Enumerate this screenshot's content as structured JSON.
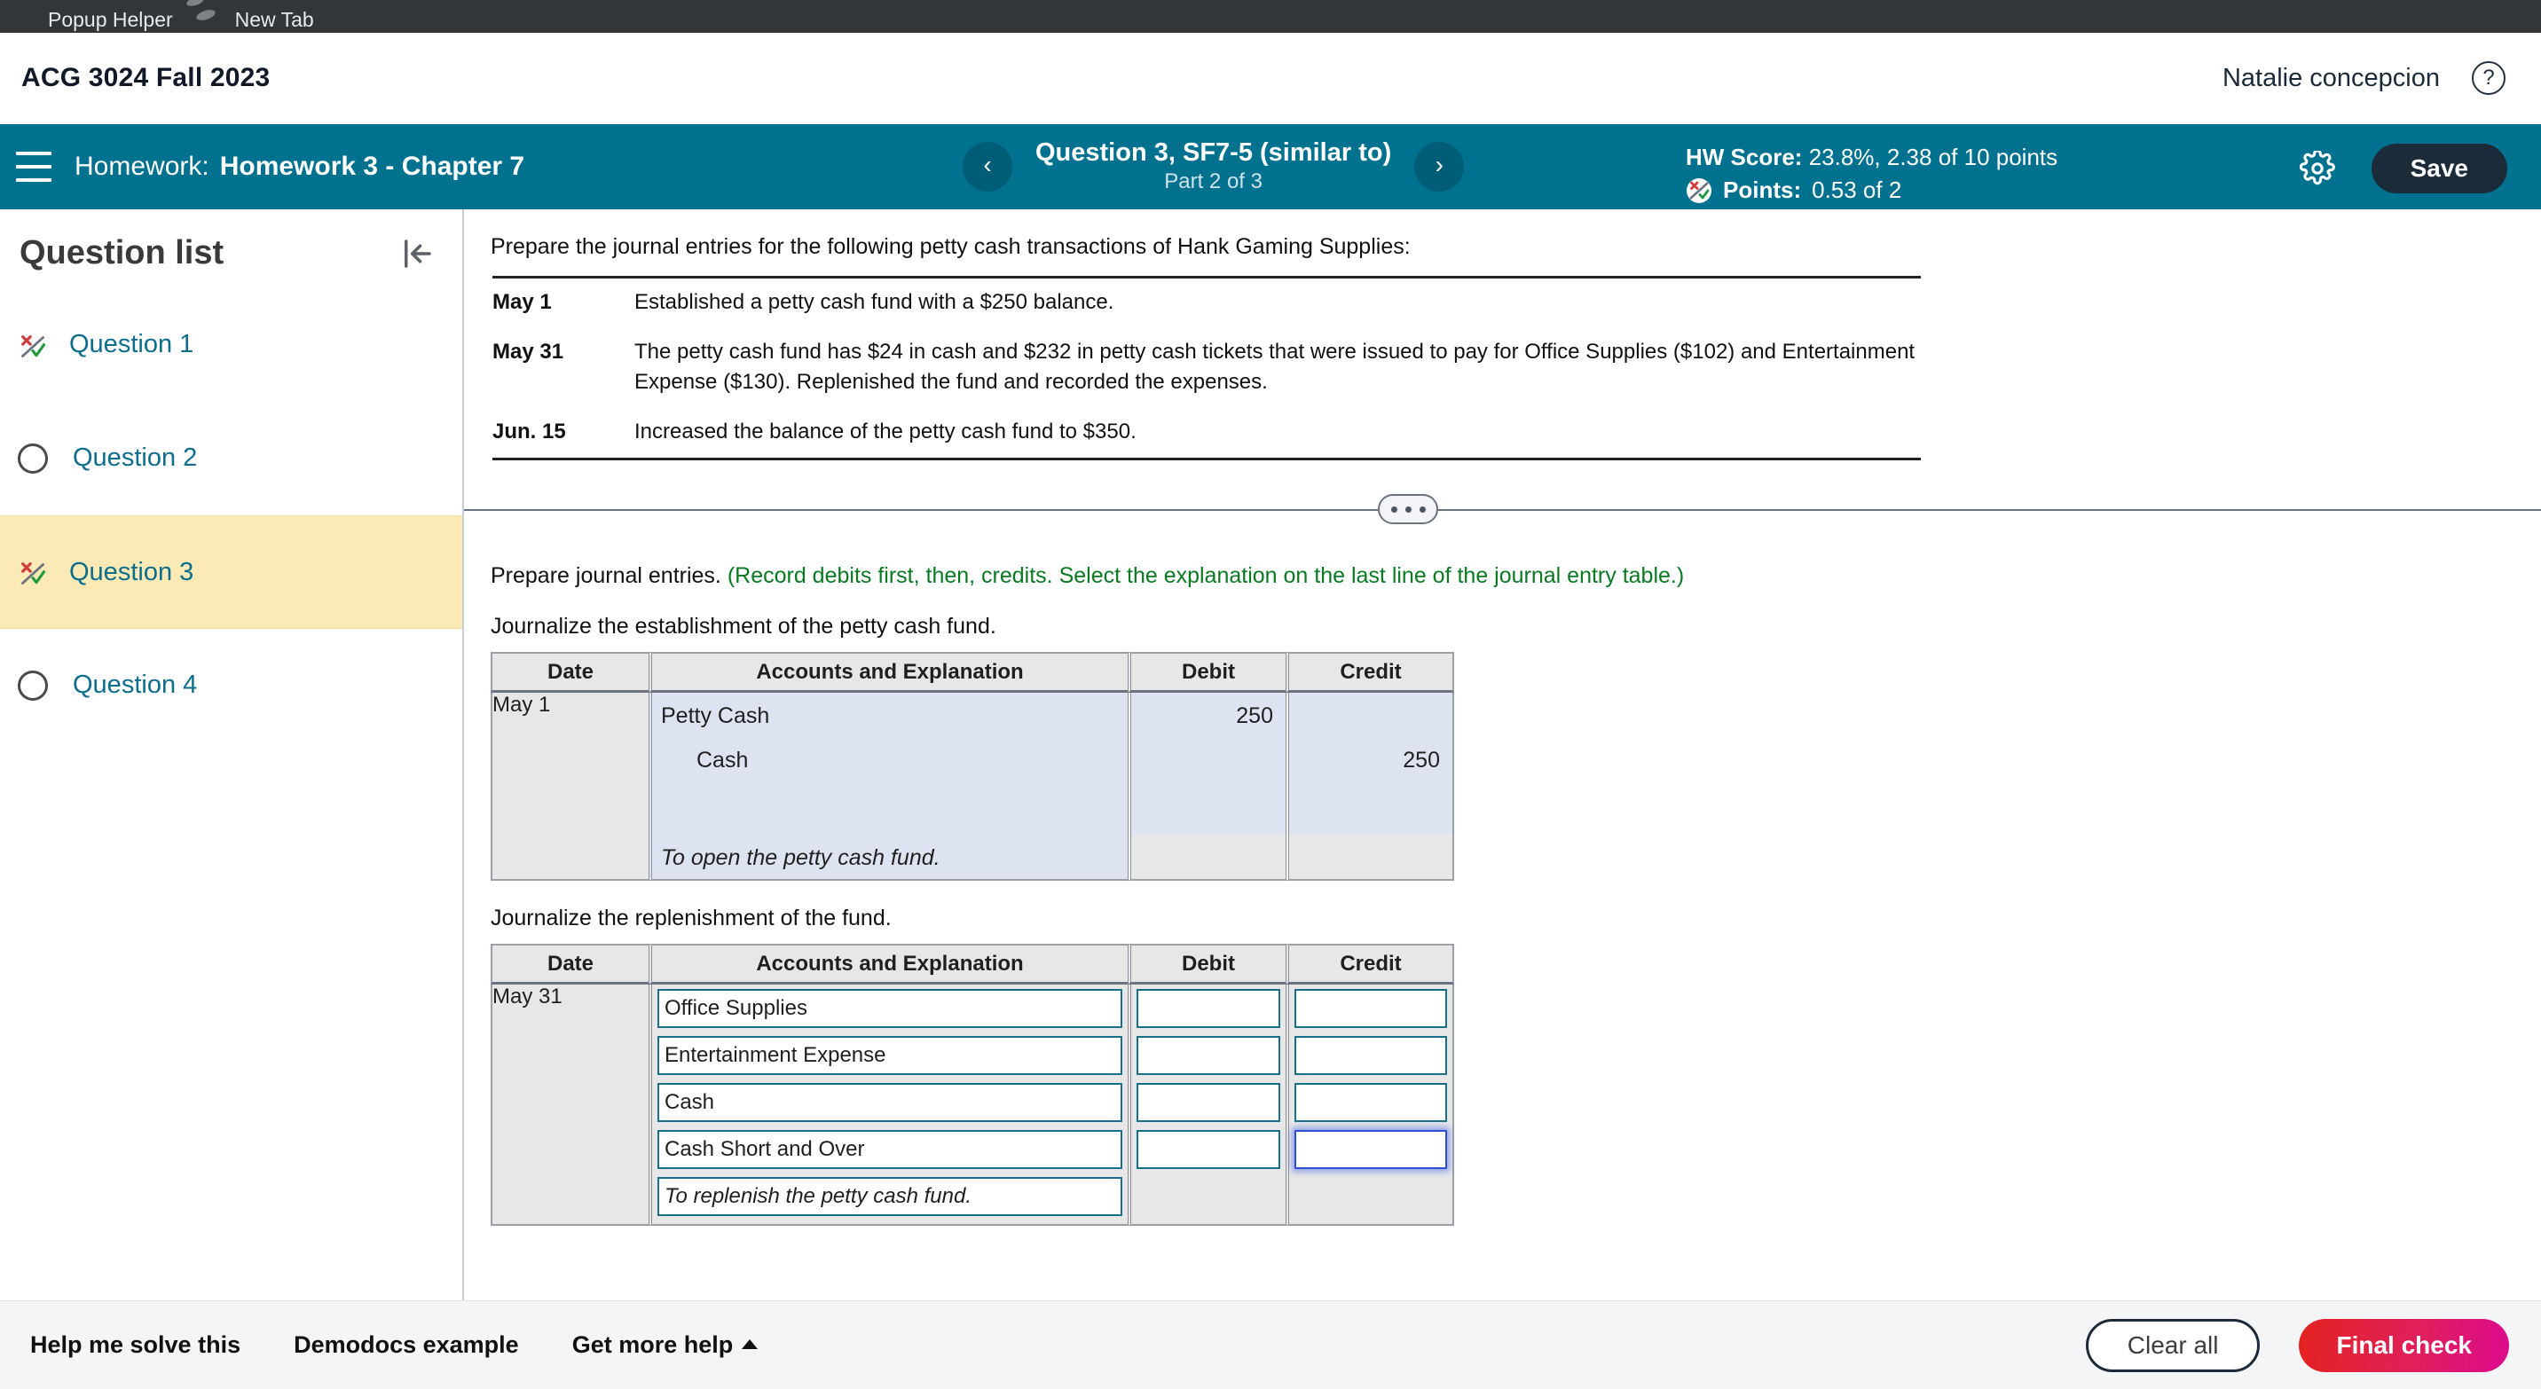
{
  "browser": {
    "tabs": [
      {
        "title": "Popup Helper",
        "icon": "popup-helper-icon"
      },
      {
        "title": "New Tab",
        "icon": "globe-icon"
      }
    ]
  },
  "course_header": {
    "title": "ACG 3024 Fall 2023",
    "user_name": "Natalie concepcion",
    "help_icon": "question-mark-circle-icon"
  },
  "toolbar": {
    "menu_icon": "hamburger-menu-icon",
    "homework_label": "Homework:",
    "homework_name": "Homework 3 - Chapter 7",
    "prev_icon": "chevron-left-icon",
    "next_icon": "chevron-right-icon",
    "question_title": "Question 3, SF7-5 (similar to)",
    "question_part": "Part 2 of 3",
    "hw_score_label": "HW Score:",
    "hw_score_value": "23.8%, 2.38 of 10 points",
    "points_label": "Points:",
    "points_value": "0.53 of 2",
    "points_icon": "partial-credit-icon",
    "settings_icon": "gear-icon",
    "save_label": "Save",
    "accent_teal": "#00718f",
    "save_bg": "#1c2b39"
  },
  "sidebar": {
    "title": "Question list",
    "collapse_icon": "collapse-left-icon",
    "items": [
      {
        "label": "Question 1",
        "status": "partial",
        "icon": "partial-credit-icon",
        "active": false
      },
      {
        "label": "Question 2",
        "status": "unanswered",
        "icon": "empty-circle-icon",
        "active": false
      },
      {
        "label": "Question 3",
        "status": "partial",
        "icon": "partial-credit-icon",
        "active": true
      },
      {
        "label": "Question 4",
        "status": "unanswered",
        "icon": "empty-circle-icon",
        "active": false
      }
    ],
    "active_bg": "#fbeab5"
  },
  "problem": {
    "intro": "Prepare the journal entries for the following petty cash transactions of Hank Gaming Supplies:",
    "transactions": [
      {
        "date": "May 1",
        "text": "Established a petty cash fund with a $250 balance."
      },
      {
        "date": "May 31",
        "text": "The petty cash fund has $24 in cash and $232 in petty cash tickets that were issued to pay for Office Supplies ($102) and Entertainment Expense ($130). Replenished the fund and recorded the expenses."
      },
      {
        "date": "Jun. 15",
        "text": "Increased the balance of the petty cash fund to $350."
      }
    ],
    "expand_icon": "ellipsis-pill-icon"
  },
  "instructions": {
    "lead": "Prepare journal entries. ",
    "green_note": "(Record debits first, then, credits. Select the explanation on the last line of the journal entry table.)",
    "green_color": "#0a7a22",
    "part1_label": "Journalize the establishment of the petty cash fund.",
    "part2_label": "Journalize the replenishment of the fund."
  },
  "journal_columns": {
    "date": "Date",
    "accounts": "Accounts and Explanation",
    "debit": "Debit",
    "credit": "Credit"
  },
  "journal_table_1": {
    "date": "May 1",
    "rows": [
      {
        "account": "Petty Cash",
        "indent": false,
        "debit": "250",
        "credit": ""
      },
      {
        "account": "Cash",
        "indent": true,
        "debit": "",
        "credit": "250"
      }
    ],
    "explanation": "To open the petty cash fund.",
    "filled_bg": "#dde3f0"
  },
  "journal_table_2": {
    "date": "May 31",
    "rows": [
      {
        "account": "Office Supplies",
        "debit": "",
        "credit": "",
        "credit_focused": false
      },
      {
        "account": "Entertainment Expense",
        "debit": "",
        "credit": "",
        "credit_focused": false
      },
      {
        "account": "Cash",
        "debit": "",
        "credit": "",
        "credit_focused": false
      },
      {
        "account": "Cash Short and Over",
        "debit": "",
        "credit": "",
        "credit_focused": true
      }
    ],
    "explanation": "To replenish the petty cash fund.",
    "input_border": "#17708b",
    "focus_border": "#2b4fd1"
  },
  "bottom_bar": {
    "help_solve": "Help me solve this",
    "demodocs": "Demodocs example",
    "get_more_help": "Get more help",
    "get_more_help_icon": "caret-up-icon",
    "clear_all": "Clear all",
    "final_check": "Final check",
    "final_check_gradient_from": "#e32320",
    "final_check_gradient_to": "#dc0a8e"
  }
}
